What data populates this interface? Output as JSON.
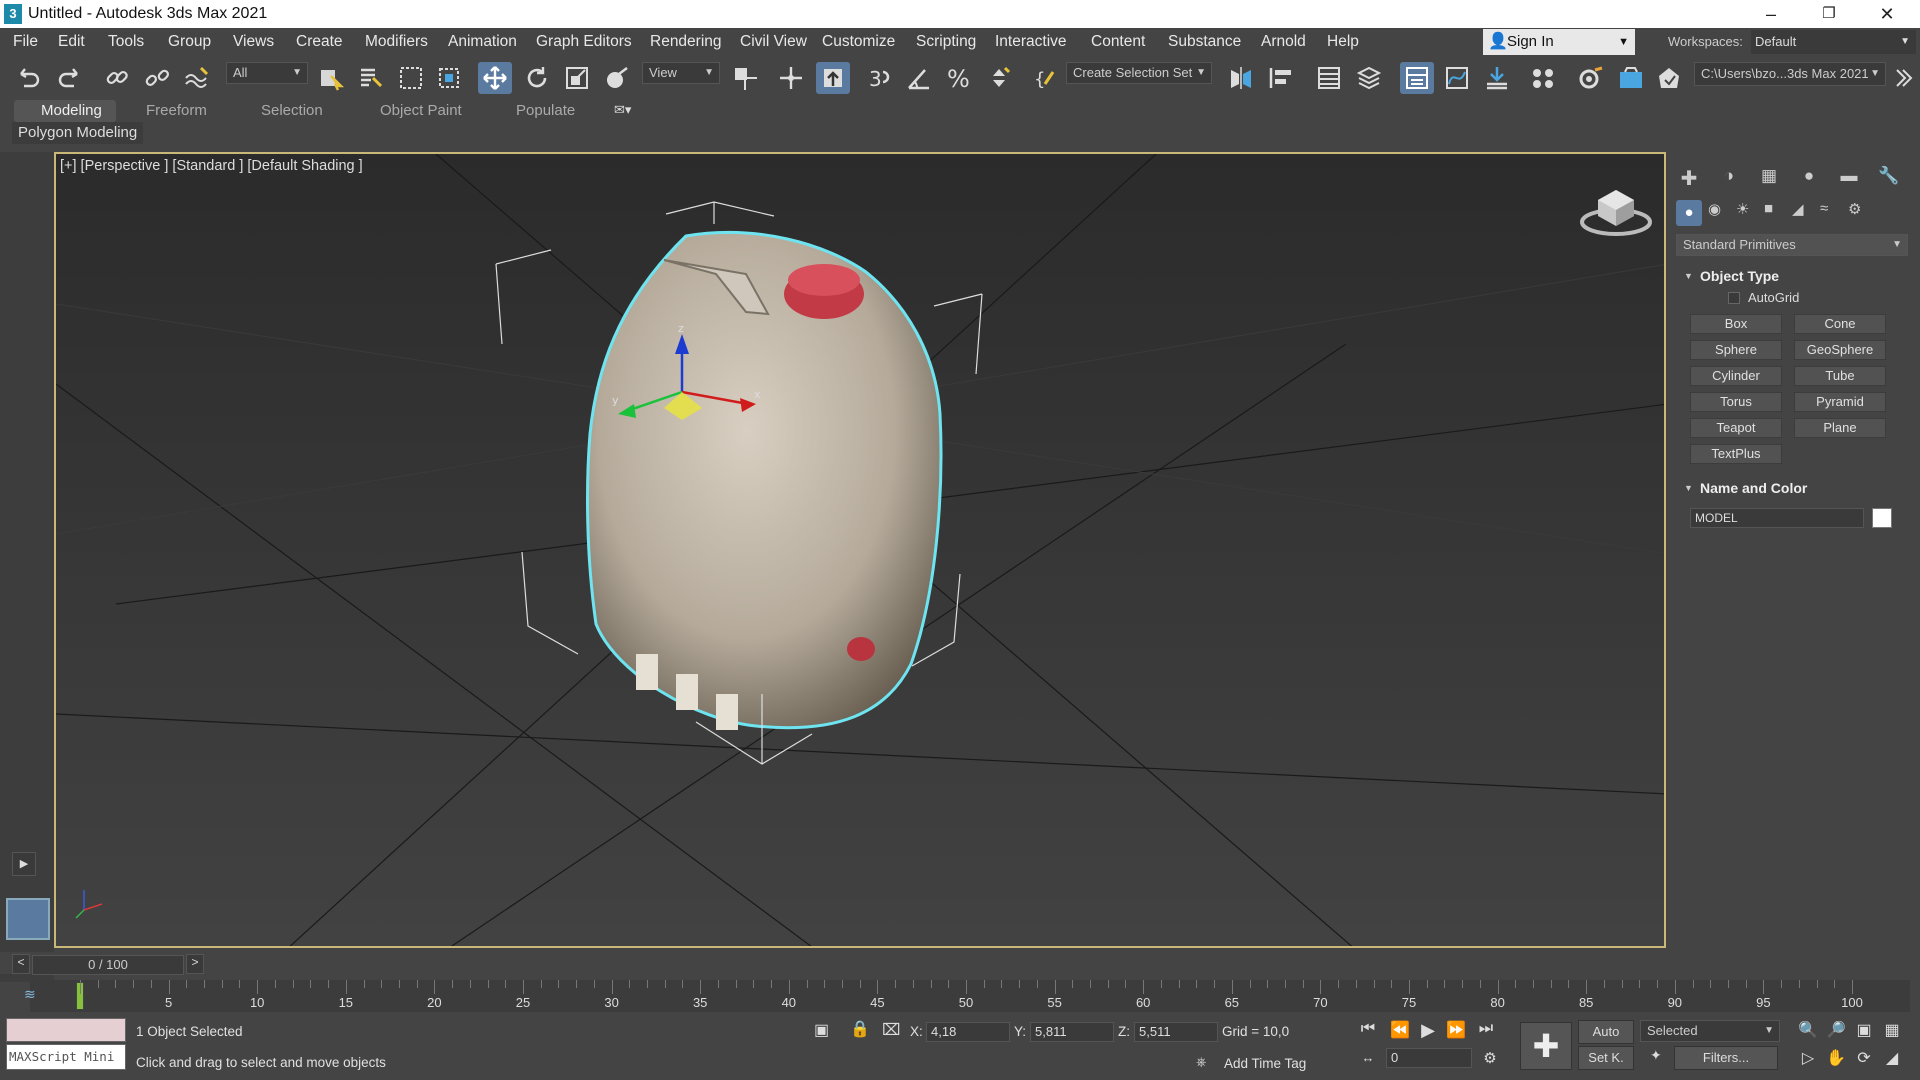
{
  "app": {
    "title": "Untitled - Autodesk 3ds Max 2021",
    "logo": "3"
  },
  "menu": [
    "File",
    "Edit",
    "Tools",
    "Group",
    "Views",
    "Create",
    "Modifiers",
    "Animation",
    "Graph Editors",
    "Rendering",
    "Civil View",
    "Customize",
    "Scripting",
    "Interactive",
    "Content",
    "Substance",
    "Arnold",
    "Help"
  ],
  "signin": {
    "label": "Sign In"
  },
  "workspaces": {
    "label": "Workspaces:",
    "value": "Default"
  },
  "toolbar": {
    "filter": "All",
    "ref_coord": "View",
    "selection_set": "Create Selection Set",
    "project_path": "C:\\Users\\bzo...3ds Max 2021"
  },
  "ribbon": {
    "tabs": [
      "Modeling",
      "Freeform",
      "Selection",
      "Object Paint",
      "Populate"
    ],
    "active": "Modeling",
    "sub": "Polygon Modeling"
  },
  "viewport": {
    "label": "[+] [Perspective ] [Standard ] [Default Shading ]",
    "gizmo_labels": [
      "z",
      "y",
      "x"
    ]
  },
  "command_panel": {
    "category": "Standard Primitives",
    "object_type": {
      "header": "Object Type",
      "autogrid": "AutoGrid",
      "buttons": [
        "Box",
        "Cone",
        "Sphere",
        "GeoSphere",
        "Cylinder",
        "Tube",
        "Torus",
        "Pyramid",
        "Teapot",
        "Plane",
        "TextPlus"
      ]
    },
    "name_color": {
      "header": "Name and Color",
      "name": "MODEL",
      "color": "#ffffff"
    }
  },
  "timeline": {
    "slider": "0 / 100",
    "ticks": [
      "5",
      "10",
      "15",
      "20",
      "25",
      "30",
      "35",
      "40",
      "45",
      "50",
      "55",
      "60",
      "65",
      "70",
      "75",
      "80",
      "85",
      "90",
      "95",
      "100"
    ]
  },
  "status": {
    "selected": "1 Object Selected",
    "prompt": "Click and drag to select and move objects",
    "maxscript": "MAXScript Mini",
    "x_label": "X:",
    "x": "4,18",
    "y_label": "Y:",
    "y": "5,811",
    "z_label": "Z:",
    "z": "5,511",
    "grid": "Grid = 10,0",
    "add_time_tag": "Add Time Tag",
    "auto": "Auto",
    "setk": "Set K.",
    "key_mode": "Selected",
    "filters": "Filters...",
    "frame": "0"
  }
}
